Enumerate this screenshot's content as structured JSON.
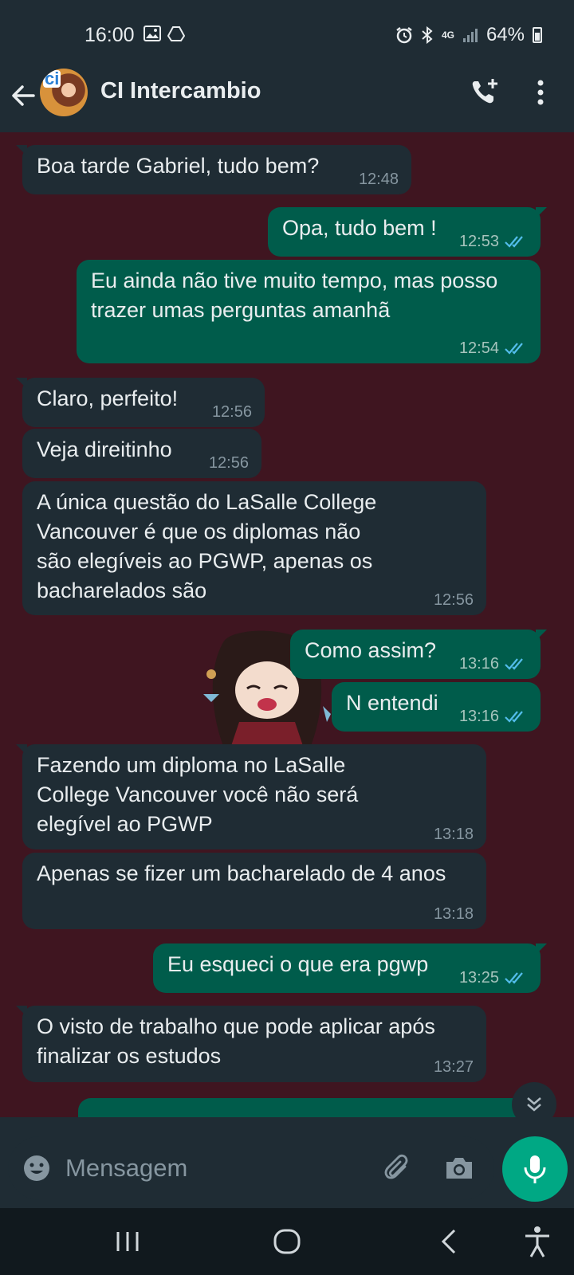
{
  "status_bar": {
    "time": "16:00",
    "network": "4G",
    "battery": "64%"
  },
  "header": {
    "avatar_text": "ci",
    "contact_name": "CI Intercambio"
  },
  "messages": [
    {
      "direction": "in",
      "text": "Boa tarde Gabriel, tudo bem?",
      "time": "12:48"
    },
    {
      "direction": "out",
      "text": "Opa, tudo bem !",
      "time": "12:53",
      "status": "read"
    },
    {
      "direction": "out",
      "text": "Eu ainda não tive muito tempo, mas posso trazer umas perguntas amanhã",
      "time": "12:54",
      "status": "read"
    },
    {
      "direction": "in",
      "text": "Claro, perfeito!",
      "time": "12:56"
    },
    {
      "direction": "in",
      "text": "Veja direitinho",
      "time": "12:56"
    },
    {
      "direction": "in",
      "text": "A única questão do LaSalle College Vancouver é que os diplomas não são elegíveis ao PGWP, apenas os bacharelados são",
      "time": "12:56"
    },
    {
      "direction": "out",
      "text": "Como assim?",
      "time": "13:16",
      "status": "read"
    },
    {
      "direction": "out",
      "text": "N entendi",
      "time": "13:16",
      "status": "read"
    },
    {
      "direction": "in",
      "text": "Fazendo um diploma no LaSalle College Vancouver você não será elegível ao PGWP",
      "time": "13:18"
    },
    {
      "direction": "in",
      "text": "Apenas se fizer um bacharelado de 4 anos",
      "time": "13:18"
    },
    {
      "direction": "out",
      "text": "Eu esqueci o que era pgwp",
      "time": "13:25",
      "status": "read"
    },
    {
      "direction": "in",
      "text": "O visto de trabalho que pode aplicar após finalizar os estudos",
      "time": "13:27"
    }
  ],
  "composer": {
    "placeholder": "Mensagem"
  },
  "colors": {
    "wallpaper": "#3f1520",
    "incoming_bubble": "#1f2c34",
    "outgoing_bubble": "#005c4b",
    "read_tick": "#53bdeb",
    "mic_button": "#00a884"
  }
}
